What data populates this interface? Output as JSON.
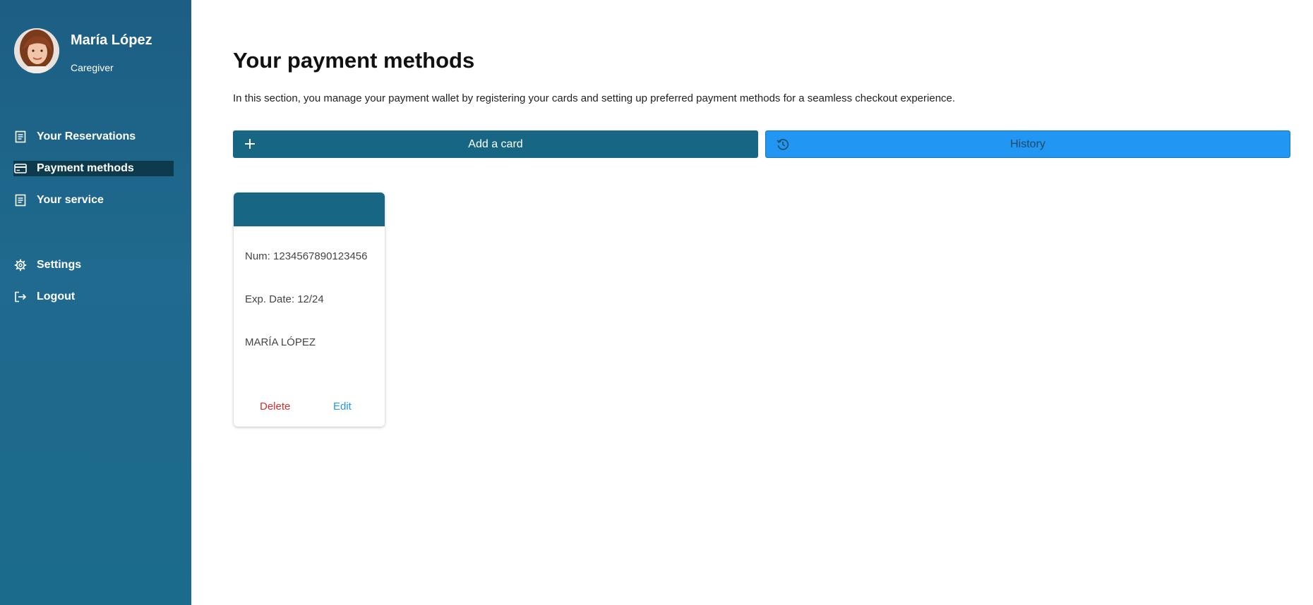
{
  "user": {
    "name": "María López",
    "role": "Caregiver"
  },
  "nav": {
    "reservations": "Your Reservations",
    "payment_methods": "Payment methods",
    "your_service": "Your service",
    "settings": "Settings",
    "logout": "Logout"
  },
  "page": {
    "title": "Your payment methods",
    "description": "In this section, you manage your payment wallet by registering your cards and setting up preferred payment methods for a seamless checkout experience."
  },
  "actions": {
    "add_card": "Add a card",
    "history": "History"
  },
  "cards": [
    {
      "number": "Num: 1234567890123456",
      "expiry": "Exp. Date: 12/24",
      "holder": "MARÍA LÓPEZ",
      "delete_label": "Delete",
      "edit_label": "Edit"
    }
  ],
  "colors": {
    "sidebar": "#1d6488",
    "active_nav": "#0e3a4d",
    "primary": "#176784",
    "history_button": "#2196f3",
    "delete": "#d32f2f",
    "edit": "#2196f3"
  },
  "icons": {
    "reservations": "document-icon",
    "payment_methods": "credit-card-icon",
    "your_service": "document-icon",
    "settings": "gear-icon",
    "logout": "logout-icon",
    "add_card": "plus-icon",
    "history": "history-icon"
  }
}
